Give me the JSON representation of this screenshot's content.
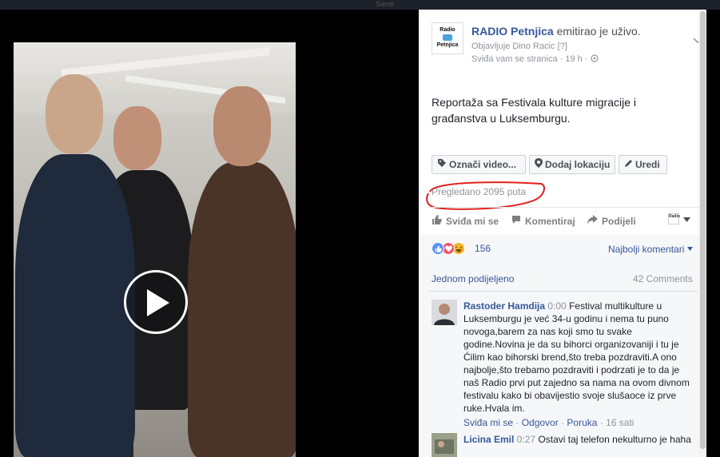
{
  "topbar": {
    "hint": "Samir"
  },
  "post": {
    "page_name": "RADIO Petnjica",
    "action": "emitirao je uživo.",
    "published_by": "Objavljuje Dino Racic",
    "help_mark": "[?]",
    "meta": "Sviđa vam se stranica · 19 h ·",
    "logo_line1": "Radio",
    "logo_line2": "Petnjica",
    "text": "Reportaža sa Festivala kulture migracije i građanstva u Luksemburgu.",
    "buttons": {
      "tag": "Označi video...",
      "location": "Dodaj lokaciju",
      "edit": "Uredi"
    },
    "views": "Pregledano 2095 puta"
  },
  "actions": {
    "like": "Sviđa mi se",
    "comment": "Komentiraj",
    "share": "Podijeli"
  },
  "reactions": {
    "count": "156",
    "sort_label": "Najbolji komentari"
  },
  "shares": {
    "label": "Jednom podijeljeno",
    "comment_count": "42 Comments"
  },
  "comments": [
    {
      "name": "Rastoder Hamdija",
      "time": "0:00",
      "text": "Festival multikulture u Luksemburgu je već 34-u godinu i nema tu puno novoga,barem za nas koji smo tu svake godine.Novina je da su bihorci organizovaniji i tu je Ćilim kao bihorski brend,što treba pozdraviti.A ono najbolje,što trebamo pozdraviti i podrzati je to da je naš Radio prvi put zajedno sa nama na ovom divnom festivalu kako bi obavijestio svoje slušaoce iz prve ruke.Hvala im.",
      "like": "Sviđa mi se",
      "reply": "Odgovor",
      "message": "Poruka",
      "age": "16 sati"
    },
    {
      "name": "Licina Emil",
      "time": "0:27",
      "text": "Ostavi taj telefon nekulturno je haha"
    }
  ],
  "colors": {
    "link": "#365899",
    "muted": "#90949c",
    "annotation": "#e0201e",
    "like_blue": "#5890ff",
    "love_red": "#f25268",
    "haha_yellow": "#f7b125"
  },
  "icons": [
    "play-icon",
    "tag-icon",
    "location-pin-icon",
    "pencil-icon",
    "thumb-up-icon",
    "comment-icon",
    "share-arrow-icon",
    "globe-icon",
    "chevron-down-icon"
  ]
}
